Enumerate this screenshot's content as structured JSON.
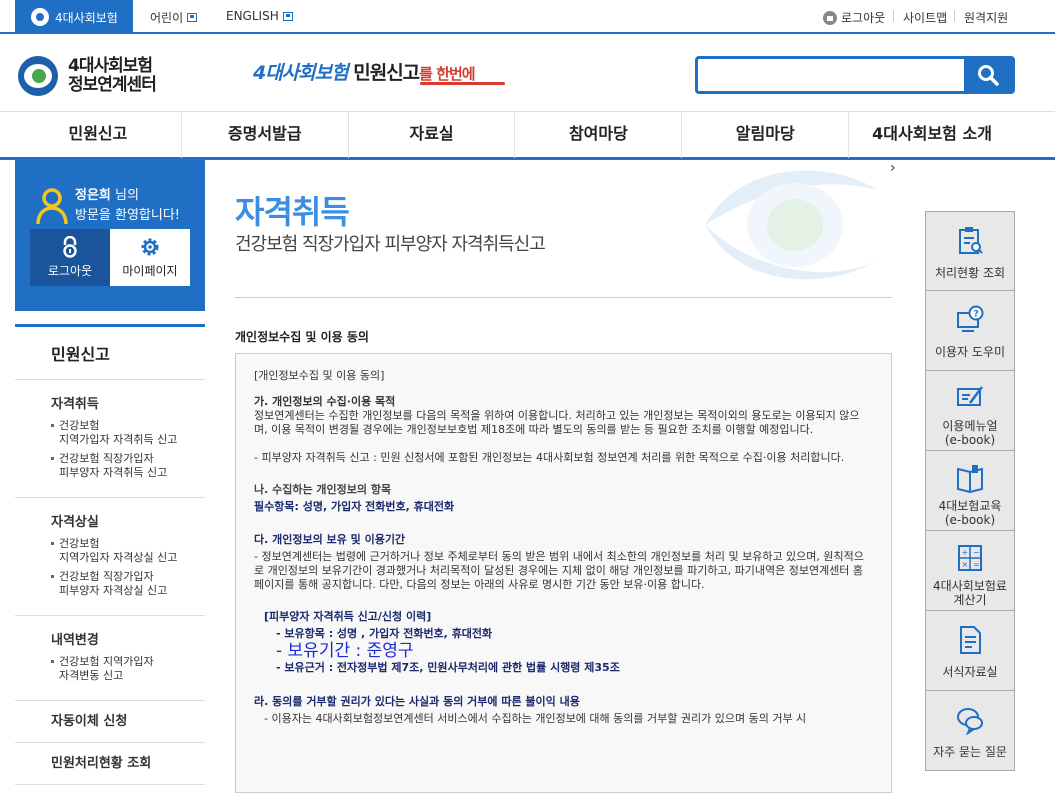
{
  "topbar": {
    "home_tab": "4대사회보험",
    "kids": "어린이",
    "english": "ENGLISH",
    "logout": "로그아웃",
    "sitemap": "사이트맵",
    "remote": "원격지원"
  },
  "header": {
    "brand_line1": "4대사회보험",
    "brand_line2": "정보연계센터",
    "slogan_part1": "4대사회보험",
    "slogan_part2": " 민원신고",
    "slogan_part3": "를 한번에",
    "search_placeholder": ""
  },
  "gnb": [
    "민원신고",
    "증명서발급",
    "자료실",
    "참여마당",
    "알림마당",
    "4대사회보험 소개"
  ],
  "welcome": {
    "user_name": "정은희",
    "suffix": " 님의",
    "line2": "방문을 환영합니다!",
    "logout": "로그아웃",
    "mypage": "마이페이지"
  },
  "leftnav": {
    "title": "민원신고",
    "groups": [
      {
        "head": "자격취득",
        "items": [
          "건강보험\n지역가입자 자격취득 신고",
          "건강보험 직장가입자\n피부양자 자격취득 신고"
        ]
      },
      {
        "head": "자격상실",
        "items": [
          "건강보험\n지역가입자 자격상실 신고",
          "건강보험 직장가입자\n피부양자 자격상실 신고"
        ]
      },
      {
        "head": "내역변경",
        "items": [
          "건강보험 지역가입자\n자격변동 신고"
        ]
      }
    ],
    "singles": [
      "자동이체 신청",
      "민원처리현황 조회"
    ]
  },
  "main": {
    "title": "자격취득",
    "subtitle": "건강보험 직장가입자 피부양자 자격취득신고",
    "section_title": "개인정보수집 및 이용 동의",
    "agreement": {
      "heading": "[개인정보수집 및 이용 동의]",
      "a_title": "가. 개인정보의 수집·이용 목적",
      "a_body": "정보연계센터는 수집한 개인정보를 다음의 목적을 위하여 이용합니다. 처리하고 있는 개인정보는 목적이외의 용도로는 이용되지 않으며, 이용 목적이 변경될 경우에는 개인정보보호법 제18조에 따라 별도의 동의를 받는 등 필요한 조치를 이행할 예정입니다.",
      "a_item": "- 피부양자 자격취득 신고 : 민원 신청서에 포함된 개인정보는 4대사회보험 정보연계 처리를 위한 목적으로 수집·이용 처리합니다.",
      "b_title": "나. 수집하는 개인정보의 항목",
      "b_body": "필수항목: 성명, 가입자 전화번호, 휴대전화",
      "c_title": "다. 개인정보의 보유 및 이용기간",
      "c_body": "- 정보연계센터는 법령에 근거하거나 정보 주체로부터 동의 받은 범위 내에서 최소한의 개인정보를 처리 및 보유하고 있으며, 원칙적으로 개인정보의 보유기간이 경과했거나 처리목적이 달성된 경우에는 지체 없이 해당 개인정보를 파기하고, 파기내역은 정보연계센터 홈페이지를 통해 공지합니다. 다만, 다음의 정보는 아래의 사유로 명시한 기간 동안 보유·이용 합니다.",
      "c_sub_title": "[피부양자 자격취득 신고/신청 이력]",
      "c_sub_1": "- 보유항목 : 성명 , 가입자 전화번호, 휴대전화",
      "c_sub_2": "- 보유기간 : 준영구",
      "c_sub_3": "- 보유근거 : 전자정부법 제7조, 민원사무처리에 관한 법률 시행령 제35조",
      "d_title": "라. 동의를 거부할 권리가 있다는 사실과 동의 거부에 따른 불이익 내용",
      "d_body": "- 이용자는 4대사회보험정보연계센터 서비스에서 수집하는 개인정보에 대해 동의를 거부할 권리가 있으며 동의 거부 시"
    }
  },
  "quickmenu": [
    {
      "label": "처리현황 조회",
      "icon": "clipboard-search-icon"
    },
    {
      "label": "이용자 도우미",
      "icon": "help-monitor-icon"
    },
    {
      "label": "이용메뉴얼\n(e-book)",
      "icon": "pencil-board-icon"
    },
    {
      "label": "4대보험교육\n(e-book)",
      "icon": "book-icon"
    },
    {
      "label": "4대사회보험료\n계산기",
      "icon": "calculator-icon"
    },
    {
      "label": "서식자료실",
      "icon": "document-icon"
    },
    {
      "label": "자주 묻는 질문",
      "icon": "chat-bubble-icon"
    }
  ],
  "colors": {
    "primary": "#1f6fc5",
    "title_blue": "#3d8ee0",
    "navy": "#1b2a6e",
    "accent_red": "#d83a2e"
  }
}
